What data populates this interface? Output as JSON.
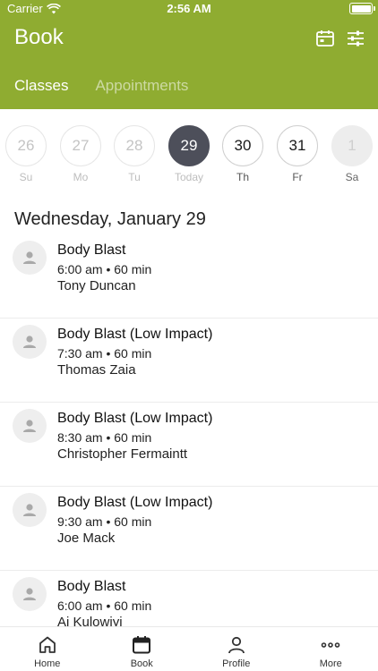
{
  "status_bar": {
    "carrier": "Carrier",
    "time": "2:56 AM"
  },
  "header": {
    "title": "Book"
  },
  "tabs": [
    {
      "label": "Classes",
      "active": true
    },
    {
      "label": "Appointments",
      "active": false
    }
  ],
  "week": [
    {
      "num": "26",
      "label": "Su",
      "state": "past"
    },
    {
      "num": "27",
      "label": "Mo",
      "state": "past"
    },
    {
      "num": "28",
      "label": "Tu",
      "state": "past"
    },
    {
      "num": "29",
      "label": "Today",
      "state": "today"
    },
    {
      "num": "30",
      "label": "Th",
      "state": "future"
    },
    {
      "num": "31",
      "label": "Fr",
      "state": "future"
    },
    {
      "num": "1",
      "label": "Sa",
      "state": "disabled"
    }
  ],
  "date_heading": "Wednesday, January 29",
  "classes": [
    {
      "name": "Body Blast",
      "meta": "6:00 am • 60 min",
      "coach": "Tony Duncan"
    },
    {
      "name": "Body Blast (Low Impact)",
      "meta": "7:30 am • 60 min",
      "coach": "Thomas Zaia"
    },
    {
      "name": "Body Blast (Low Impact)",
      "meta": "8:30 am • 60 min",
      "coach": "Christopher Fermaintt"
    },
    {
      "name": "Body Blast (Low Impact)",
      "meta": "9:30 am • 60 min",
      "coach": "Joe Mack"
    },
    {
      "name": "Body Blast",
      "meta": "6:00 am • 60 min",
      "coach": "Aj Kulowiyi"
    }
  ],
  "tabbar": [
    {
      "label": "Home",
      "icon": "home-icon"
    },
    {
      "label": "Book",
      "icon": "calendar-icon"
    },
    {
      "label": "Profile",
      "icon": "person-icon"
    },
    {
      "label": "More",
      "icon": "more-icon"
    }
  ],
  "colors": {
    "brand": "#8fac31",
    "today": "#4d4f5a"
  }
}
